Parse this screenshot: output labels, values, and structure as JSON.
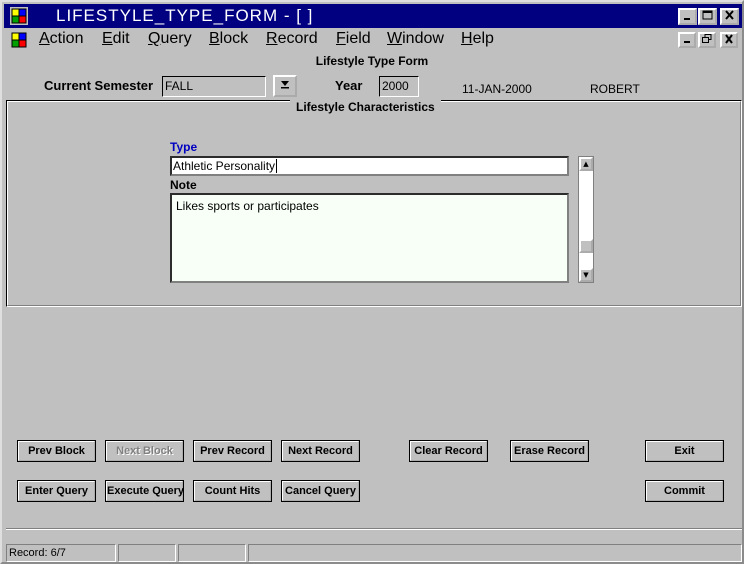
{
  "window": {
    "title": "LIFESTYLE_TYPE_FORM - [ ]"
  },
  "menu": [
    {
      "label": "Action",
      "mnemonic": "A",
      "rest": "ction"
    },
    {
      "label": "Edit",
      "mnemonic": "E",
      "rest": "dit"
    },
    {
      "label": "Query",
      "mnemonic": "Q",
      "rest": "uery"
    },
    {
      "label": "Block",
      "mnemonic": "B",
      "rest": "lock"
    },
    {
      "label": "Record",
      "mnemonic": "R",
      "rest": "ecord"
    },
    {
      "label": "Field",
      "mnemonic": "F",
      "rest": "ield"
    },
    {
      "label": "Window",
      "mnemonic": "W",
      "rest": "indow"
    },
    {
      "label": "Help",
      "mnemonic": "H",
      "rest": "elp"
    }
  ],
  "form": {
    "title": "Lifestyle Type Form",
    "current_semester_label": "Current Semester",
    "current_semester_value": "FALL",
    "year_label": "Year",
    "year_value": "2000",
    "date": "11-JAN-2000",
    "user": "ROBERT"
  },
  "characteristics": {
    "title": "Lifestyle Characteristics",
    "type_label": "Type",
    "type_value": "Athletic Personality",
    "note_label": "Note",
    "note_value": "Likes sports or participates"
  },
  "buttons": {
    "prev_block": "Prev Block",
    "next_block": "Next Block",
    "prev_record": "Prev Record",
    "next_record": "Next Record",
    "clear_record": "Clear Record",
    "erase_record": "Erase Record",
    "exit": "Exit",
    "enter_query": "Enter Query",
    "execute_query": "Execute Query",
    "count_hits": "Count Hits",
    "cancel_query": "Cancel Query",
    "commit": "Commit"
  },
  "status": {
    "record": "Record: 6/7"
  },
  "icons": {
    "app": "forms-app-icon",
    "doc": "forms-document-icon",
    "minimize": "minimize-icon",
    "maximize": "maximize-icon",
    "restore": "restore-icon",
    "close": "close-icon",
    "dropdown": "dropdown-arrow-icon",
    "scroll_up": "scroll-up-icon",
    "scroll_down": "scroll-down-icon"
  }
}
